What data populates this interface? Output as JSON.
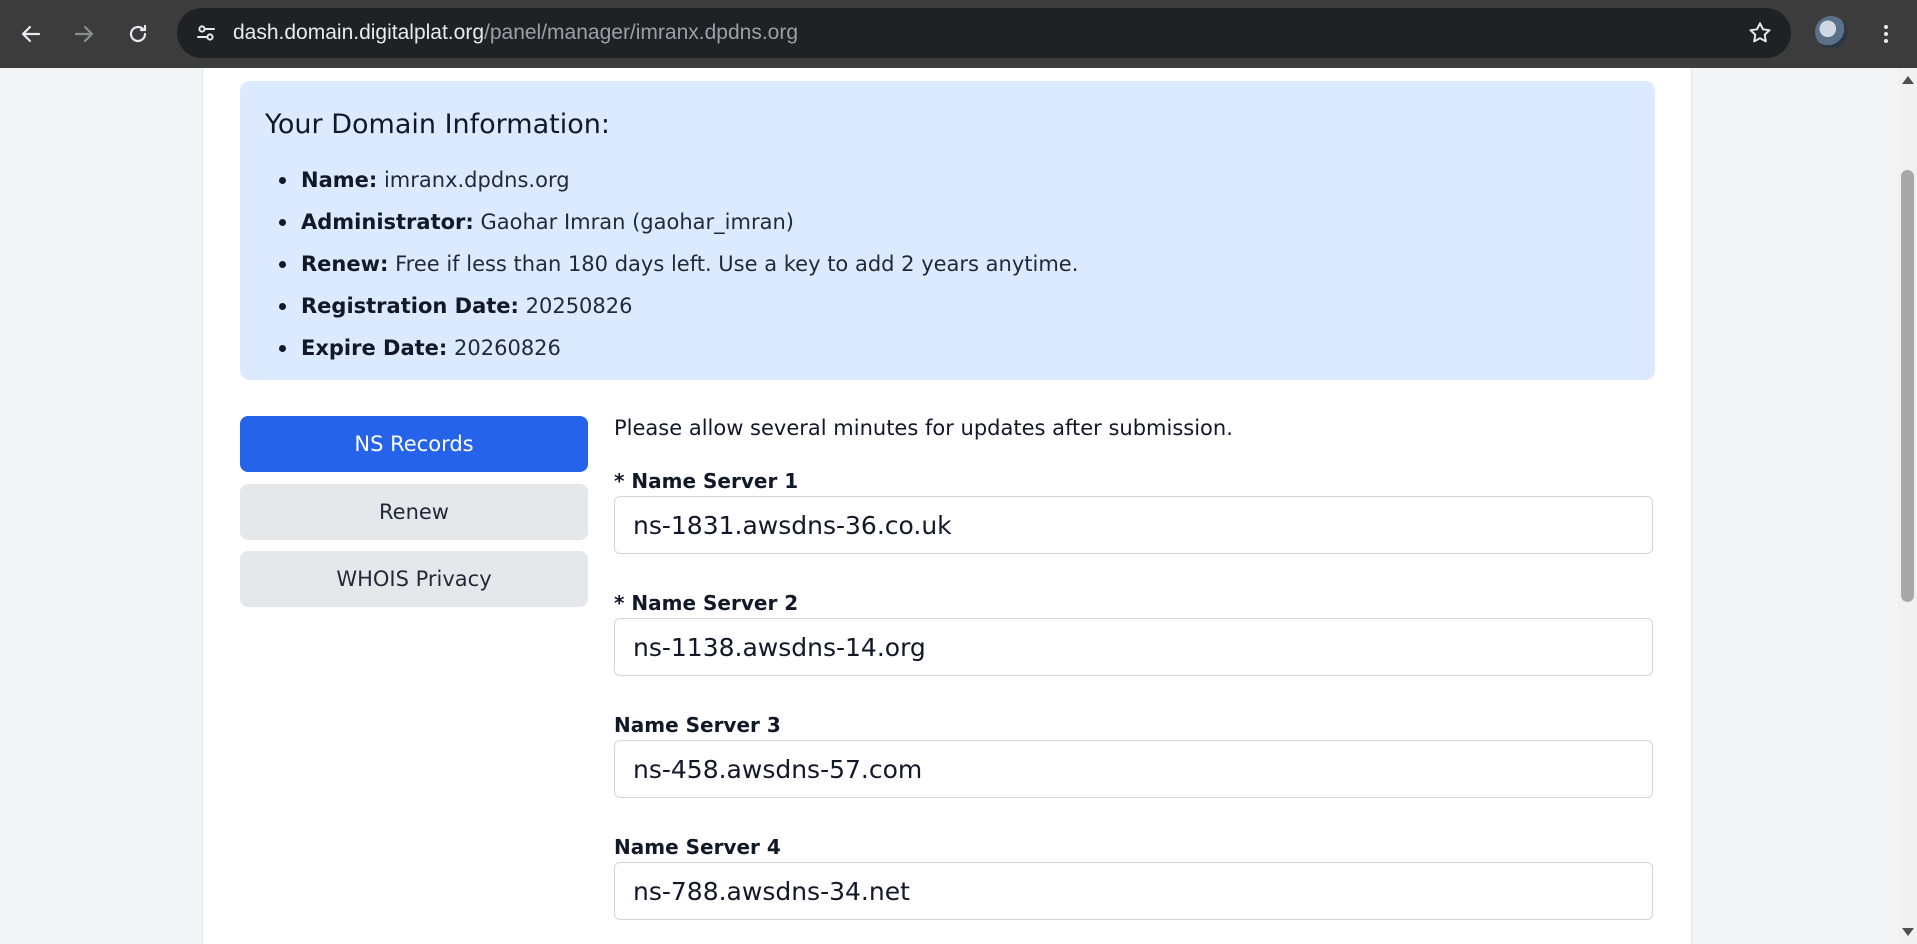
{
  "browser": {
    "url_host": "dash.domain.digitalplat.org",
    "url_path": "/panel/manager/imranx.dpdns.org",
    "icons": {
      "back": "back-arrow-icon",
      "forward": "forward-arrow-icon",
      "reload": "reload-icon",
      "site_info": "tune-icon",
      "bookmark": "star-icon",
      "menu": "kebab-menu-icon"
    }
  },
  "domain_info": {
    "title": "Your Domain Information:",
    "items": [
      {
        "label": "Name:",
        "value": "imranx.dpdns.org"
      },
      {
        "label": "Administrator:",
        "value": "Gaohar Imran (gaohar_imran)"
      },
      {
        "label": "Renew:",
        "value": "Free if less than 180 days left. Use a key to add 2 years anytime."
      },
      {
        "label": "Registration Date:",
        "value": "20250826"
      },
      {
        "label": "Expire Date:",
        "value": "20260826"
      }
    ]
  },
  "tabs": [
    {
      "label": "NS Records",
      "active": true
    },
    {
      "label": "Renew",
      "active": false
    },
    {
      "label": "WHOIS Privacy",
      "active": false
    }
  ],
  "ns_form": {
    "notice": "Please allow several minutes for updates after submission.",
    "fields": [
      {
        "label": "* Name Server 1",
        "value": "ns-1831.awsdns-36.co.uk"
      },
      {
        "label": "* Name Server 2",
        "value": "ns-1138.awsdns-14.org"
      },
      {
        "label": "Name Server 3",
        "value": "ns-458.awsdns-57.com"
      },
      {
        "label": "Name Server 4",
        "value": "ns-788.awsdns-34.net"
      }
    ]
  },
  "colors": {
    "accent": "#2563eb",
    "info_bg": "#dbeafe",
    "inactive_tab": "#e5e7eb"
  }
}
